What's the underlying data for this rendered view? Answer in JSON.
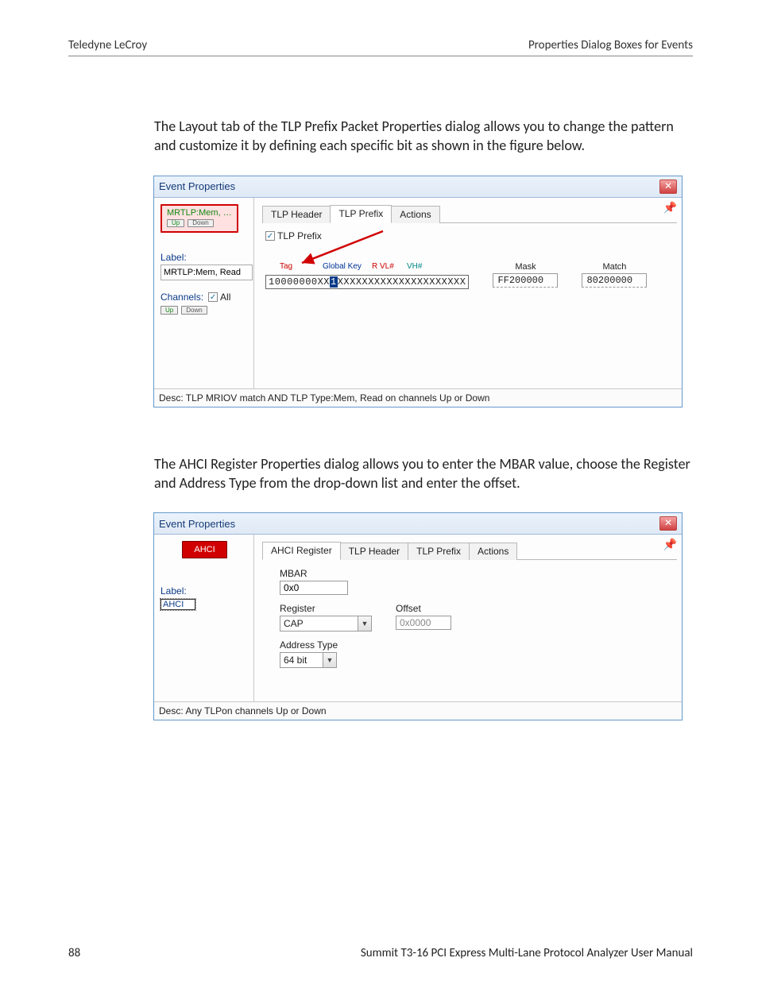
{
  "header": {
    "left": "Teledyne LeCroy",
    "right": "Properties Dialog Boxes for Events"
  },
  "para1": "The Layout tab of the TLP Prefix Packet Properties dialog allows you to change the pattern and customize it by defining each specific bit as shown in the figure below.",
  "para2": "The AHCI Register Properties dialog allows you to enter the MBAR value, choose the Register and Address Type from the drop-down list and enter the offset.",
  "dlg1": {
    "title": "Event Properties",
    "badge_main": "MRTLP:Mem, …",
    "badge_up": "Up",
    "badge_down": "Down",
    "label_caption": "Label:",
    "label_value": "MRTLP:Mem, Read",
    "channels_caption": "Channels:",
    "all_label": "All",
    "ch_up": "Up",
    "ch_down": "Down",
    "tabs": {
      "hdr": "TLP Header",
      "prefix": "TLP Prefix",
      "actions": "Actions"
    },
    "checkbox_label": "TLP Prefix",
    "bit_labels": {
      "tag": "Tag",
      "globalkey": "Global Key",
      "rvl": "R VL#",
      "vh": "VH#"
    },
    "bit_pattern_pre": "10000000XX",
    "bit_pattern_sel": "1",
    "bit_pattern_post": "XXXXXXXXXXXXXXXXXXXXX",
    "mask_label": "Mask",
    "mask_value": "FF200000",
    "match_label": "Match",
    "match_value": "80200000",
    "desc": "Desc: TLP MRIOV match AND TLP Type:Mem, Read on channels Up or Down"
  },
  "dlg2": {
    "title": "Event Properties",
    "badge": "AHCI",
    "label_caption": "Label:",
    "label_value": "AHCI",
    "tabs": {
      "reg": "AHCI Register",
      "hdr": "TLP Header",
      "prefix": "TLP Prefix",
      "actions": "Actions"
    },
    "mbar_label": "MBAR",
    "mbar_value": "0x0",
    "register_label": "Register",
    "register_value": "CAP",
    "offset_label": "Offset",
    "offset_value": "0x0000",
    "addrtype_label": "Address Type",
    "addrtype_value": "64 bit",
    "desc": "Desc: Any TLPon channels Up or Down"
  },
  "footer": {
    "page": "88",
    "manual": "Summit T3-16 PCI Express Multi-Lane Protocol Analyzer User Manual"
  }
}
